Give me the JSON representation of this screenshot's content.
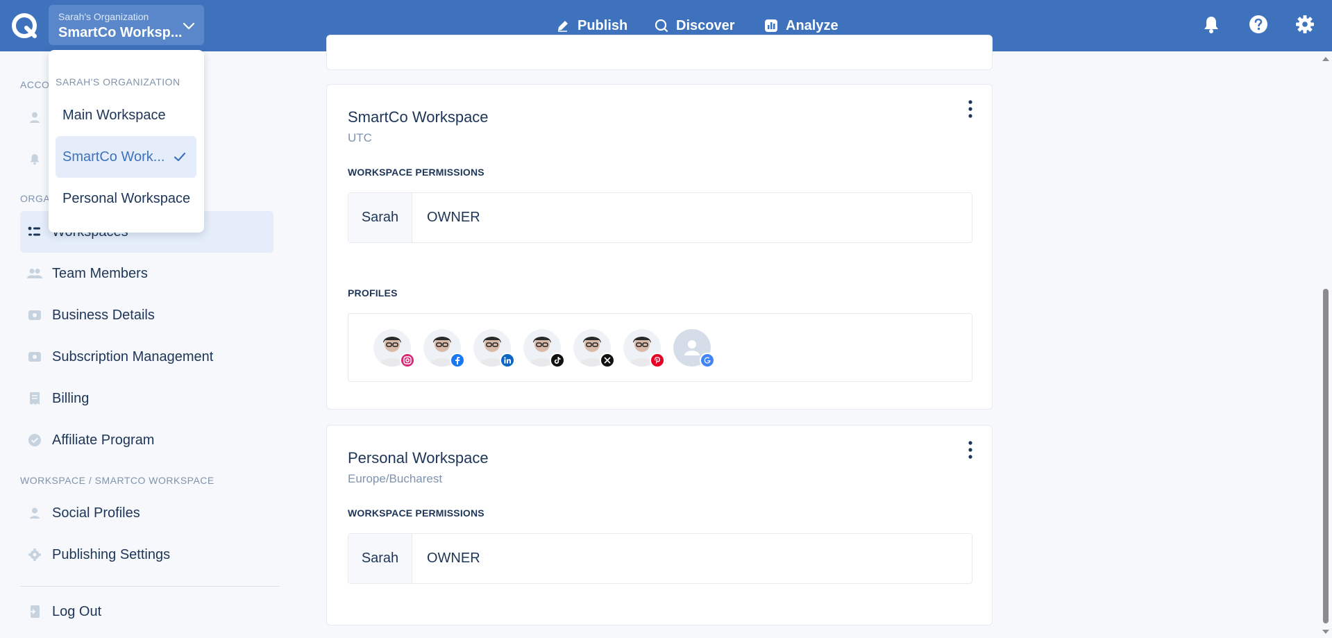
{
  "topbar": {
    "org_label": "Sarah's Organization",
    "workspace_label": "SmartCo Worksp...",
    "nav": [
      {
        "label": "Publish",
        "icon": "pen-icon"
      },
      {
        "label": "Discover",
        "icon": "search-icon"
      },
      {
        "label": "Analyze",
        "icon": "chart-icon"
      }
    ],
    "icons": [
      "bell-icon",
      "help-icon",
      "gear-icon"
    ],
    "color": "#3e72bd"
  },
  "dropdown": {
    "header": "SARAH'S ORGANIZATION",
    "items": [
      {
        "label": "Main Workspace"
      },
      {
        "label": "SmartCo Work...",
        "selected": true
      },
      {
        "label": "Personal Workspace"
      }
    ]
  },
  "sidebar": {
    "section_account": "ACCO",
    "section_org": "ORGA",
    "section_workspace": "WORKSPACE / SMARTCO WORKSPACE",
    "org_items": [
      {
        "label": "Workspaces",
        "icon": "workspaces-icon",
        "active": true
      },
      {
        "label": "Team Members",
        "icon": "team-icon"
      },
      {
        "label": "Business Details",
        "icon": "business-icon"
      },
      {
        "label": "Subscription Management",
        "icon": "subscription-icon"
      },
      {
        "label": "Billing",
        "icon": "billing-icon"
      },
      {
        "label": "Affiliate Program",
        "icon": "affiliate-icon"
      }
    ],
    "workspace_items": [
      {
        "label": "Social Profiles",
        "icon": "user-icon"
      },
      {
        "label": "Publishing Settings",
        "icon": "gear-icon"
      }
    ],
    "logout": {
      "label": "Log Out",
      "icon": "logout-icon"
    }
  },
  "cards": [
    {
      "title": "SmartCo Workspace",
      "timezone": "UTC",
      "permissions_label": "WORKSPACE PERMISSIONS",
      "user": "Sarah",
      "role": "OWNER",
      "profiles_label": "PROFILES",
      "profiles": [
        {
          "network": "instagram",
          "color": "#d62976"
        },
        {
          "network": "facebook",
          "color": "#1877f2"
        },
        {
          "network": "linkedin",
          "color": "#0a66c2"
        },
        {
          "network": "tiktok",
          "color": "#111111"
        },
        {
          "network": "x",
          "color": "#111111"
        },
        {
          "network": "pinterest",
          "color": "#e60023"
        },
        {
          "network": "google",
          "color": "#4285f4"
        }
      ]
    },
    {
      "title": "Personal Workspace",
      "timezone": "Europe/Bucharest",
      "permissions_label": "WORKSPACE PERMISSIONS",
      "user": "Sarah",
      "role": "OWNER"
    }
  ]
}
